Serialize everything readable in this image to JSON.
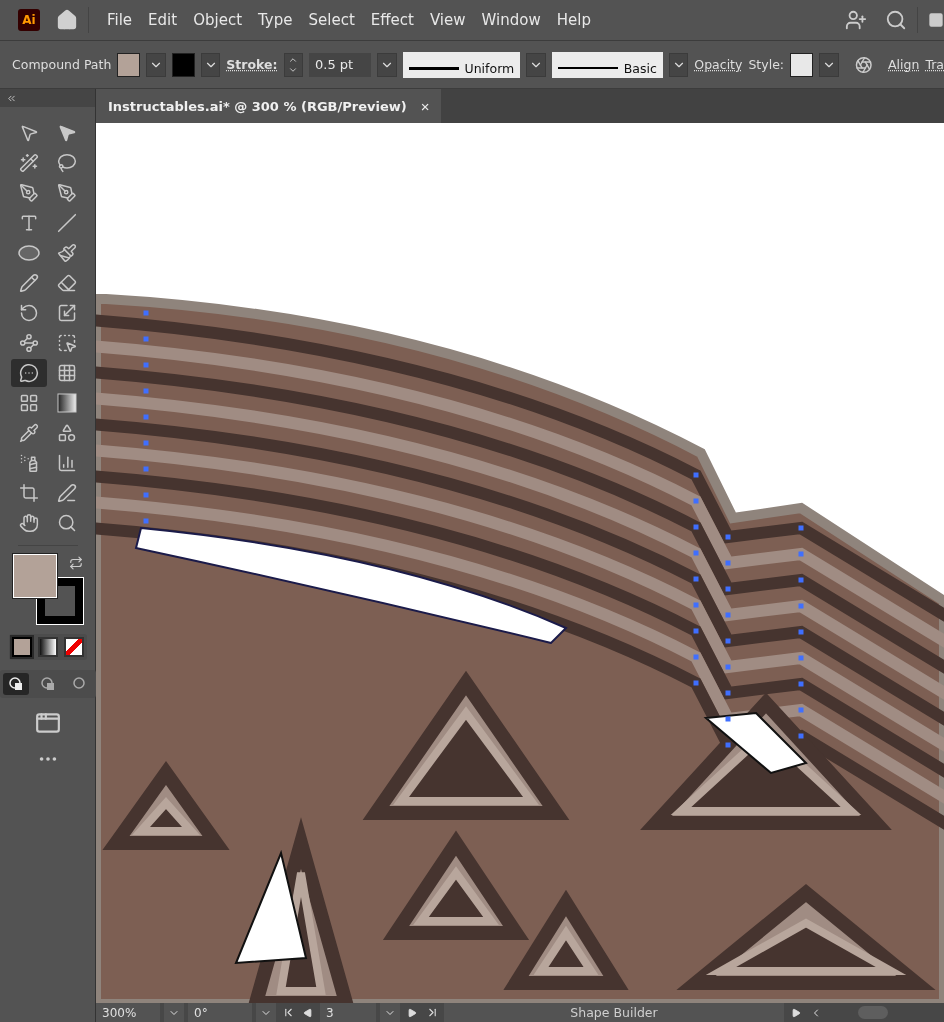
{
  "app_logo": "Ai",
  "menu": [
    "File",
    "Edit",
    "Object",
    "Type",
    "Select",
    "Effect",
    "View",
    "Window",
    "Help"
  ],
  "control_bar": {
    "selection": "Compound Path",
    "stroke_label": "Stroke:",
    "stroke_weight": "0.5 pt",
    "profile": "Uniform",
    "brush": "Basic",
    "opacity_label": "Opacity",
    "style_label": "Style:",
    "align_label": "Align",
    "transform_label": "Tra"
  },
  "document_tab": {
    "title": "Instructables.ai* @ 300 % (RGB/Preview)",
    "close": "×"
  },
  "tools": [
    {
      "kind": "selection",
      "selected": false
    },
    {
      "kind": "direct",
      "selected": false
    },
    {
      "kind": "wand",
      "selected": false
    },
    {
      "kind": "lasso",
      "selected": false
    },
    {
      "kind": "pen",
      "selected": false
    },
    {
      "kind": "curvature",
      "selected": false
    },
    {
      "kind": "type",
      "selected": false
    },
    {
      "kind": "line",
      "selected": false
    },
    {
      "kind": "ellipse",
      "selected": false
    },
    {
      "kind": "brush",
      "selected": false
    },
    {
      "kind": "shaper",
      "selected": false
    },
    {
      "kind": "eraser",
      "selected": false
    },
    {
      "kind": "rotate",
      "selected": false
    },
    {
      "kind": "scale",
      "selected": false
    },
    {
      "kind": "puppet",
      "selected": false
    },
    {
      "kind": "transform",
      "selected": false
    },
    {
      "kind": "builder",
      "selected": true
    },
    {
      "kind": "perspective",
      "selected": false
    },
    {
      "kind": "mesh",
      "selected": false
    },
    {
      "kind": "gradient",
      "selected": false
    },
    {
      "kind": "eyedropper",
      "selected": false
    },
    {
      "kind": "blend",
      "selected": false
    },
    {
      "kind": "symbol",
      "selected": false
    },
    {
      "kind": "graph",
      "selected": false
    },
    {
      "kind": "artboard",
      "selected": false
    },
    {
      "kind": "knife",
      "selected": false
    },
    {
      "kind": "hand",
      "selected": false
    },
    {
      "kind": "zoom",
      "selected": false
    }
  ],
  "color_modes": [
    {
      "kind": "color",
      "selected": true
    },
    {
      "kind": "gradient",
      "selected": false
    },
    {
      "kind": "none",
      "selected": false
    }
  ],
  "draw_modes": [
    {
      "kind": "normal",
      "selected": true
    },
    {
      "kind": "behind",
      "selected": false
    },
    {
      "kind": "inside",
      "selected": false
    }
  ],
  "status_bar": {
    "zoom": "300%",
    "rotation": "0°",
    "artboard": "3",
    "tool": "Shape Builder"
  }
}
